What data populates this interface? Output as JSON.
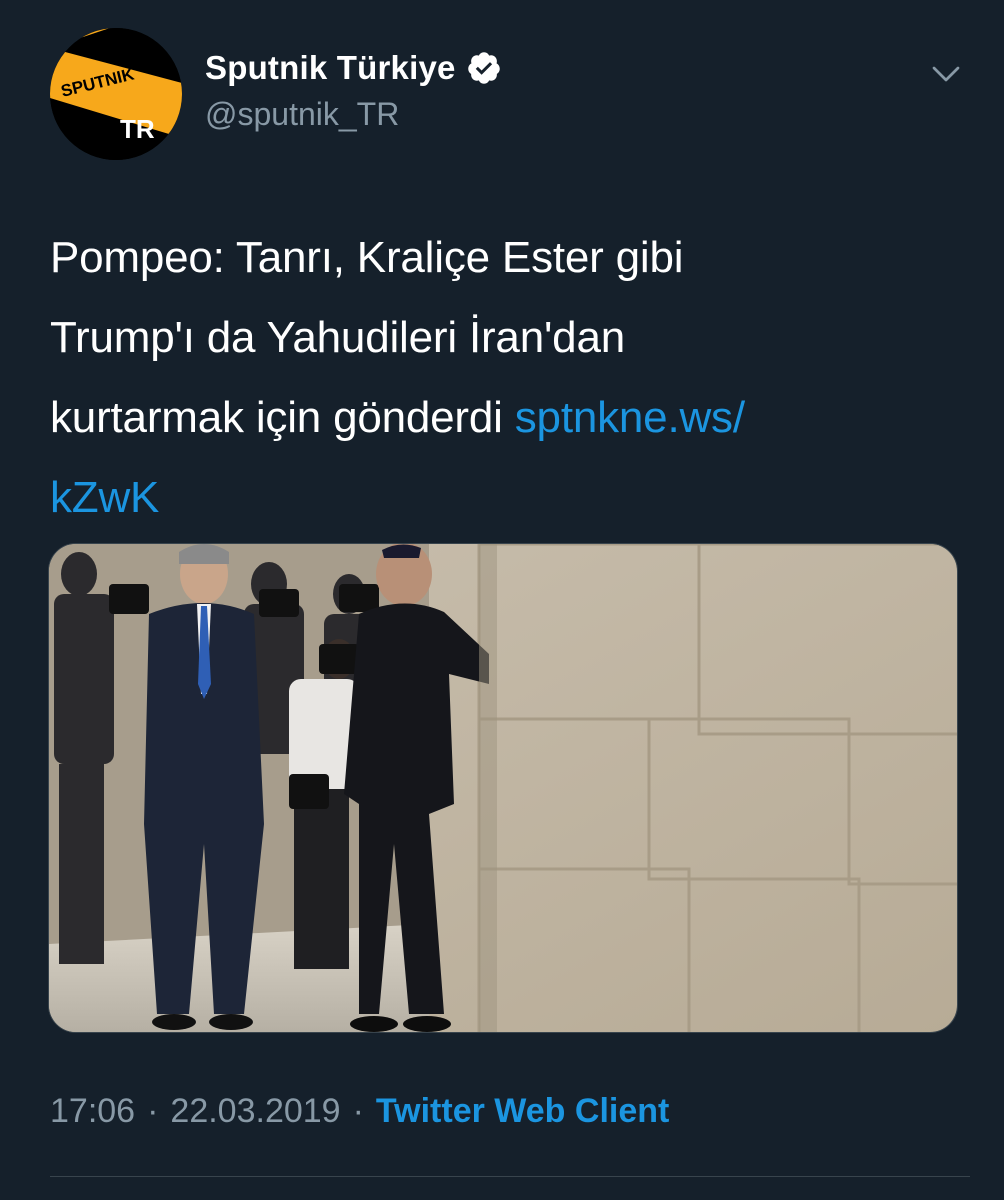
{
  "account": {
    "display_name": "Sputnik Türkiye",
    "handle": "@sputnik_TR",
    "verified": true,
    "avatar_logo_text": "SPUTNIK",
    "avatar_region_text": "TR"
  },
  "tweet": {
    "text_lines": [
      "Pompeo: Tanrı, Kraliçe Ester gibi",
      "Trump'ı da Yahudileri İran'dan",
      "kurtarmak için gönderdi "
    ],
    "link_part1": "sptnkne.ws/",
    "link_part2": "kZwK"
  },
  "meta": {
    "time": "17:06",
    "date": "22.03.2019",
    "separator": "·",
    "client": "Twitter Web Client"
  },
  "colors": {
    "background": "#15202b",
    "link": "#1b95e0",
    "secondary_text": "#8899a6",
    "avatar_orange": "#f7a81b"
  },
  "icons": {
    "verified": "verified-badge-icon",
    "menu": "chevron-down-icon"
  }
}
